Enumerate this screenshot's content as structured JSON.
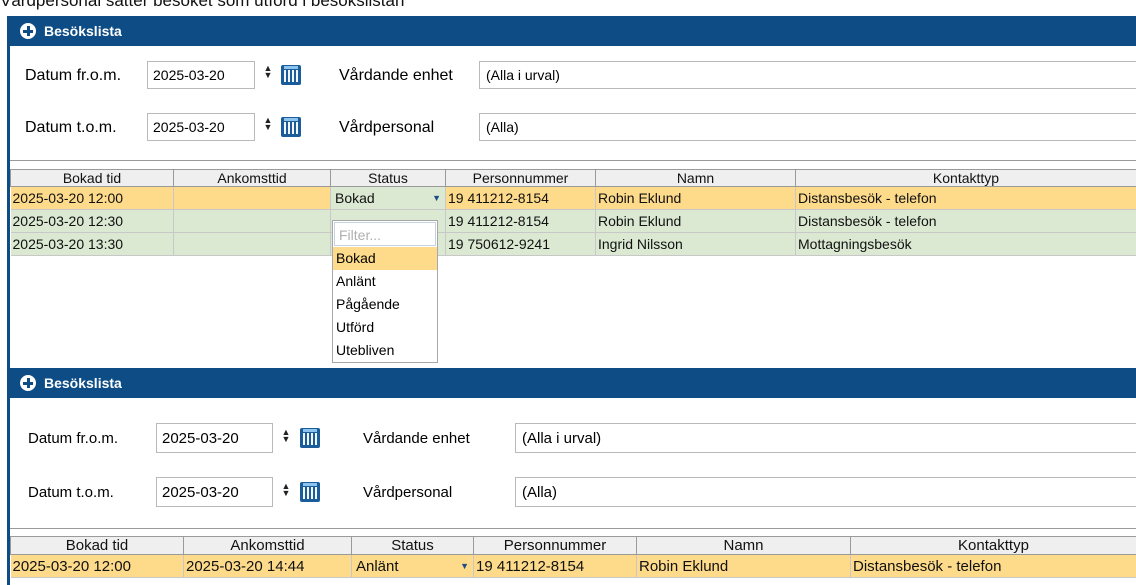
{
  "caption": "Vårdpersonal sätter besöket som utförd i besökslistan",
  "panel1": {
    "title": "Besökslista",
    "filters": {
      "date_from_label": "Datum fr.o.m.",
      "date_from_value": "2025-03-20",
      "date_to_label": "Datum t.o.m.",
      "date_to_value": "2025-03-20",
      "unit_label": "Vårdande enhet",
      "unit_value": "(Alla i urval)",
      "staff_label": "Vårdpersonal",
      "staff_value": "(Alla)"
    },
    "columns": [
      "Bokad tid",
      "Ankomsttid",
      "Status",
      "Personnummer",
      "Namn",
      "Kontakttyp"
    ],
    "rows": [
      {
        "time": "2025-03-20 12:00",
        "arrival": "",
        "status": "Bokad",
        "pnr": "19 411212-8154",
        "name": "Robin Eklund",
        "type": "Distansbesök - telefon"
      },
      {
        "time": "2025-03-20 12:30",
        "arrival": "",
        "status": "",
        "pnr": "19 411212-8154",
        "name": "Robin Eklund",
        "type": "Distansbesök - telefon"
      },
      {
        "time": "2025-03-20 13:30",
        "arrival": "",
        "status": "",
        "pnr": "19 750612-9241",
        "name": "Ingrid Nilsson",
        "type": "Mottagningsbesök"
      }
    ],
    "dropdown": {
      "filter_placeholder": "Filter...",
      "options": [
        "Bokad",
        "Anlänt",
        "Pågående",
        "Utförd",
        "Utebliven"
      ],
      "highlighted": "Bokad"
    }
  },
  "panel2": {
    "title": "Besökslista",
    "filters": {
      "date_from_label": "Datum fr.o.m.",
      "date_from_value": "2025-03-20",
      "date_to_label": "Datum t.o.m.",
      "date_to_value": "2025-03-20",
      "unit_label": "Vårdande enhet",
      "unit_value": "(Alla i urval)",
      "staff_label": "Vårdpersonal",
      "staff_value": "(Alla)"
    },
    "columns": [
      "Bokad tid",
      "Ankomsttid",
      "Status",
      "Personnummer",
      "Namn",
      "Kontakttyp"
    ],
    "rows": [
      {
        "time": "2025-03-20 12:00",
        "arrival": "2025-03-20 14:44",
        "status": "Anlänt",
        "pnr": "19 411212-8154",
        "name": "Robin Eklund",
        "type": "Distansbesök - telefon"
      }
    ]
  },
  "colors": {
    "header": "#0e4c86",
    "selected_row": "#fddb8a",
    "row": "#dbe9d3"
  }
}
